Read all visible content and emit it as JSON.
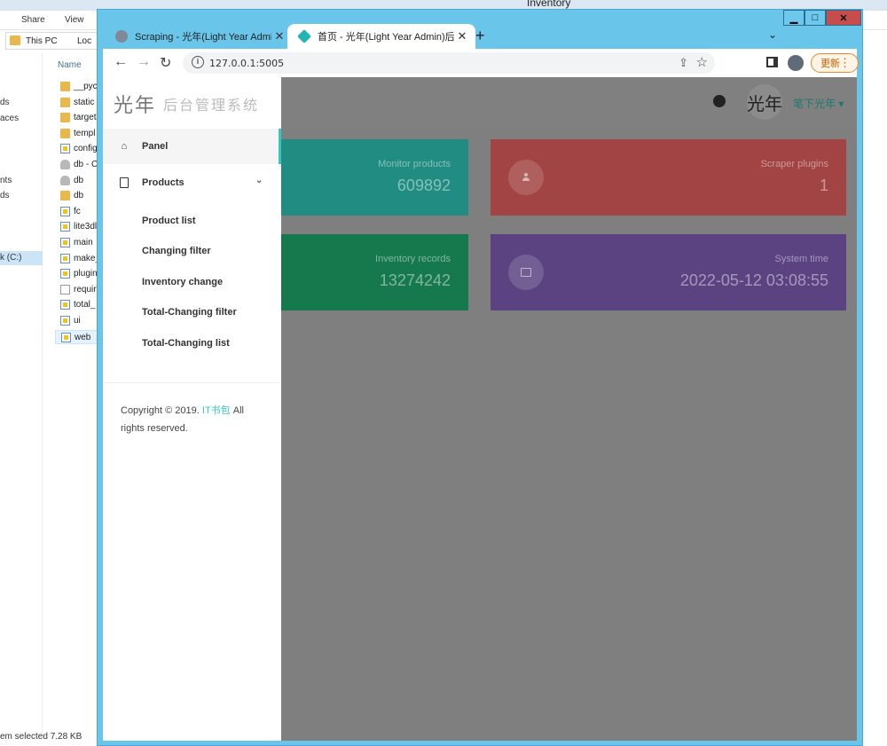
{
  "explorer": {
    "title": "Inventory",
    "ribbon": [
      "Share",
      "View"
    ],
    "address": [
      "This PC",
      "Loc"
    ],
    "left_items": [
      "ds",
      "aces",
      "nts",
      "ds"
    ],
    "drive": "k (C:)",
    "column_header": "Name",
    "files": [
      {
        "name": "__pyca",
        "type": "folder"
      },
      {
        "name": "static",
        "type": "folder"
      },
      {
        "name": "target",
        "type": "folder"
      },
      {
        "name": "templ",
        "type": "folder"
      },
      {
        "name": "config",
        "type": "py"
      },
      {
        "name": "db - C",
        "type": "db"
      },
      {
        "name": "db",
        "type": "db"
      },
      {
        "name": "db",
        "type": "folder"
      },
      {
        "name": "fc",
        "type": "py"
      },
      {
        "name": "lite3dl",
        "type": "py"
      },
      {
        "name": "main",
        "type": "py"
      },
      {
        "name": "make_",
        "type": "py"
      },
      {
        "name": "plugin",
        "type": "py"
      },
      {
        "name": "requir",
        "type": "txt"
      },
      {
        "name": "total_",
        "type": "py"
      },
      {
        "name": "ui",
        "type": "py"
      },
      {
        "name": "web",
        "type": "py"
      }
    ],
    "status": "em selected  7.28 KB"
  },
  "chrome": {
    "window_buttons": {
      "minimize": "▁",
      "restore": "□",
      "close": "✕"
    },
    "tabs": [
      {
        "title": "Scraping - 光年(Light Year Admin",
        "close": "✕"
      },
      {
        "title": "首页 - 光年(Light Year Admin)后台",
        "close": "✕"
      }
    ],
    "new_tab": "+",
    "tab_search": "⌄",
    "nav": {
      "back": "←",
      "forward": "→",
      "reload": "↻"
    },
    "url": "127.0.0.1:5005",
    "update_label": "更新",
    "menu_dots": "⋮"
  },
  "page": {
    "logo_mark": "光年",
    "logo_text": "后台管理系统",
    "user_name": "笔下光年 ▾",
    "avatar_text": "光年",
    "nav": {
      "panel": "Panel",
      "products": "Products",
      "sub_items": [
        "Product list",
        "Changing filter",
        "Inventory change",
        "Total-Changing filter",
        "Total-Changing list"
      ]
    },
    "copyright": {
      "prefix": "Copyright © 2019. ",
      "link": "IT书包",
      "suffix": " All rights reserved."
    },
    "cards": [
      {
        "label": "Monitor products",
        "value": "609892",
        "color": "#208c82"
      },
      {
        "label": "Scraper plugins",
        "value": "1",
        "color": "#a34444"
      },
      {
        "label": "Inventory records",
        "value": "13274242",
        "color": "#16794e"
      },
      {
        "label": "System time",
        "value": "2022-05-12 03:08:55",
        "color": "#5b4381"
      }
    ]
  }
}
